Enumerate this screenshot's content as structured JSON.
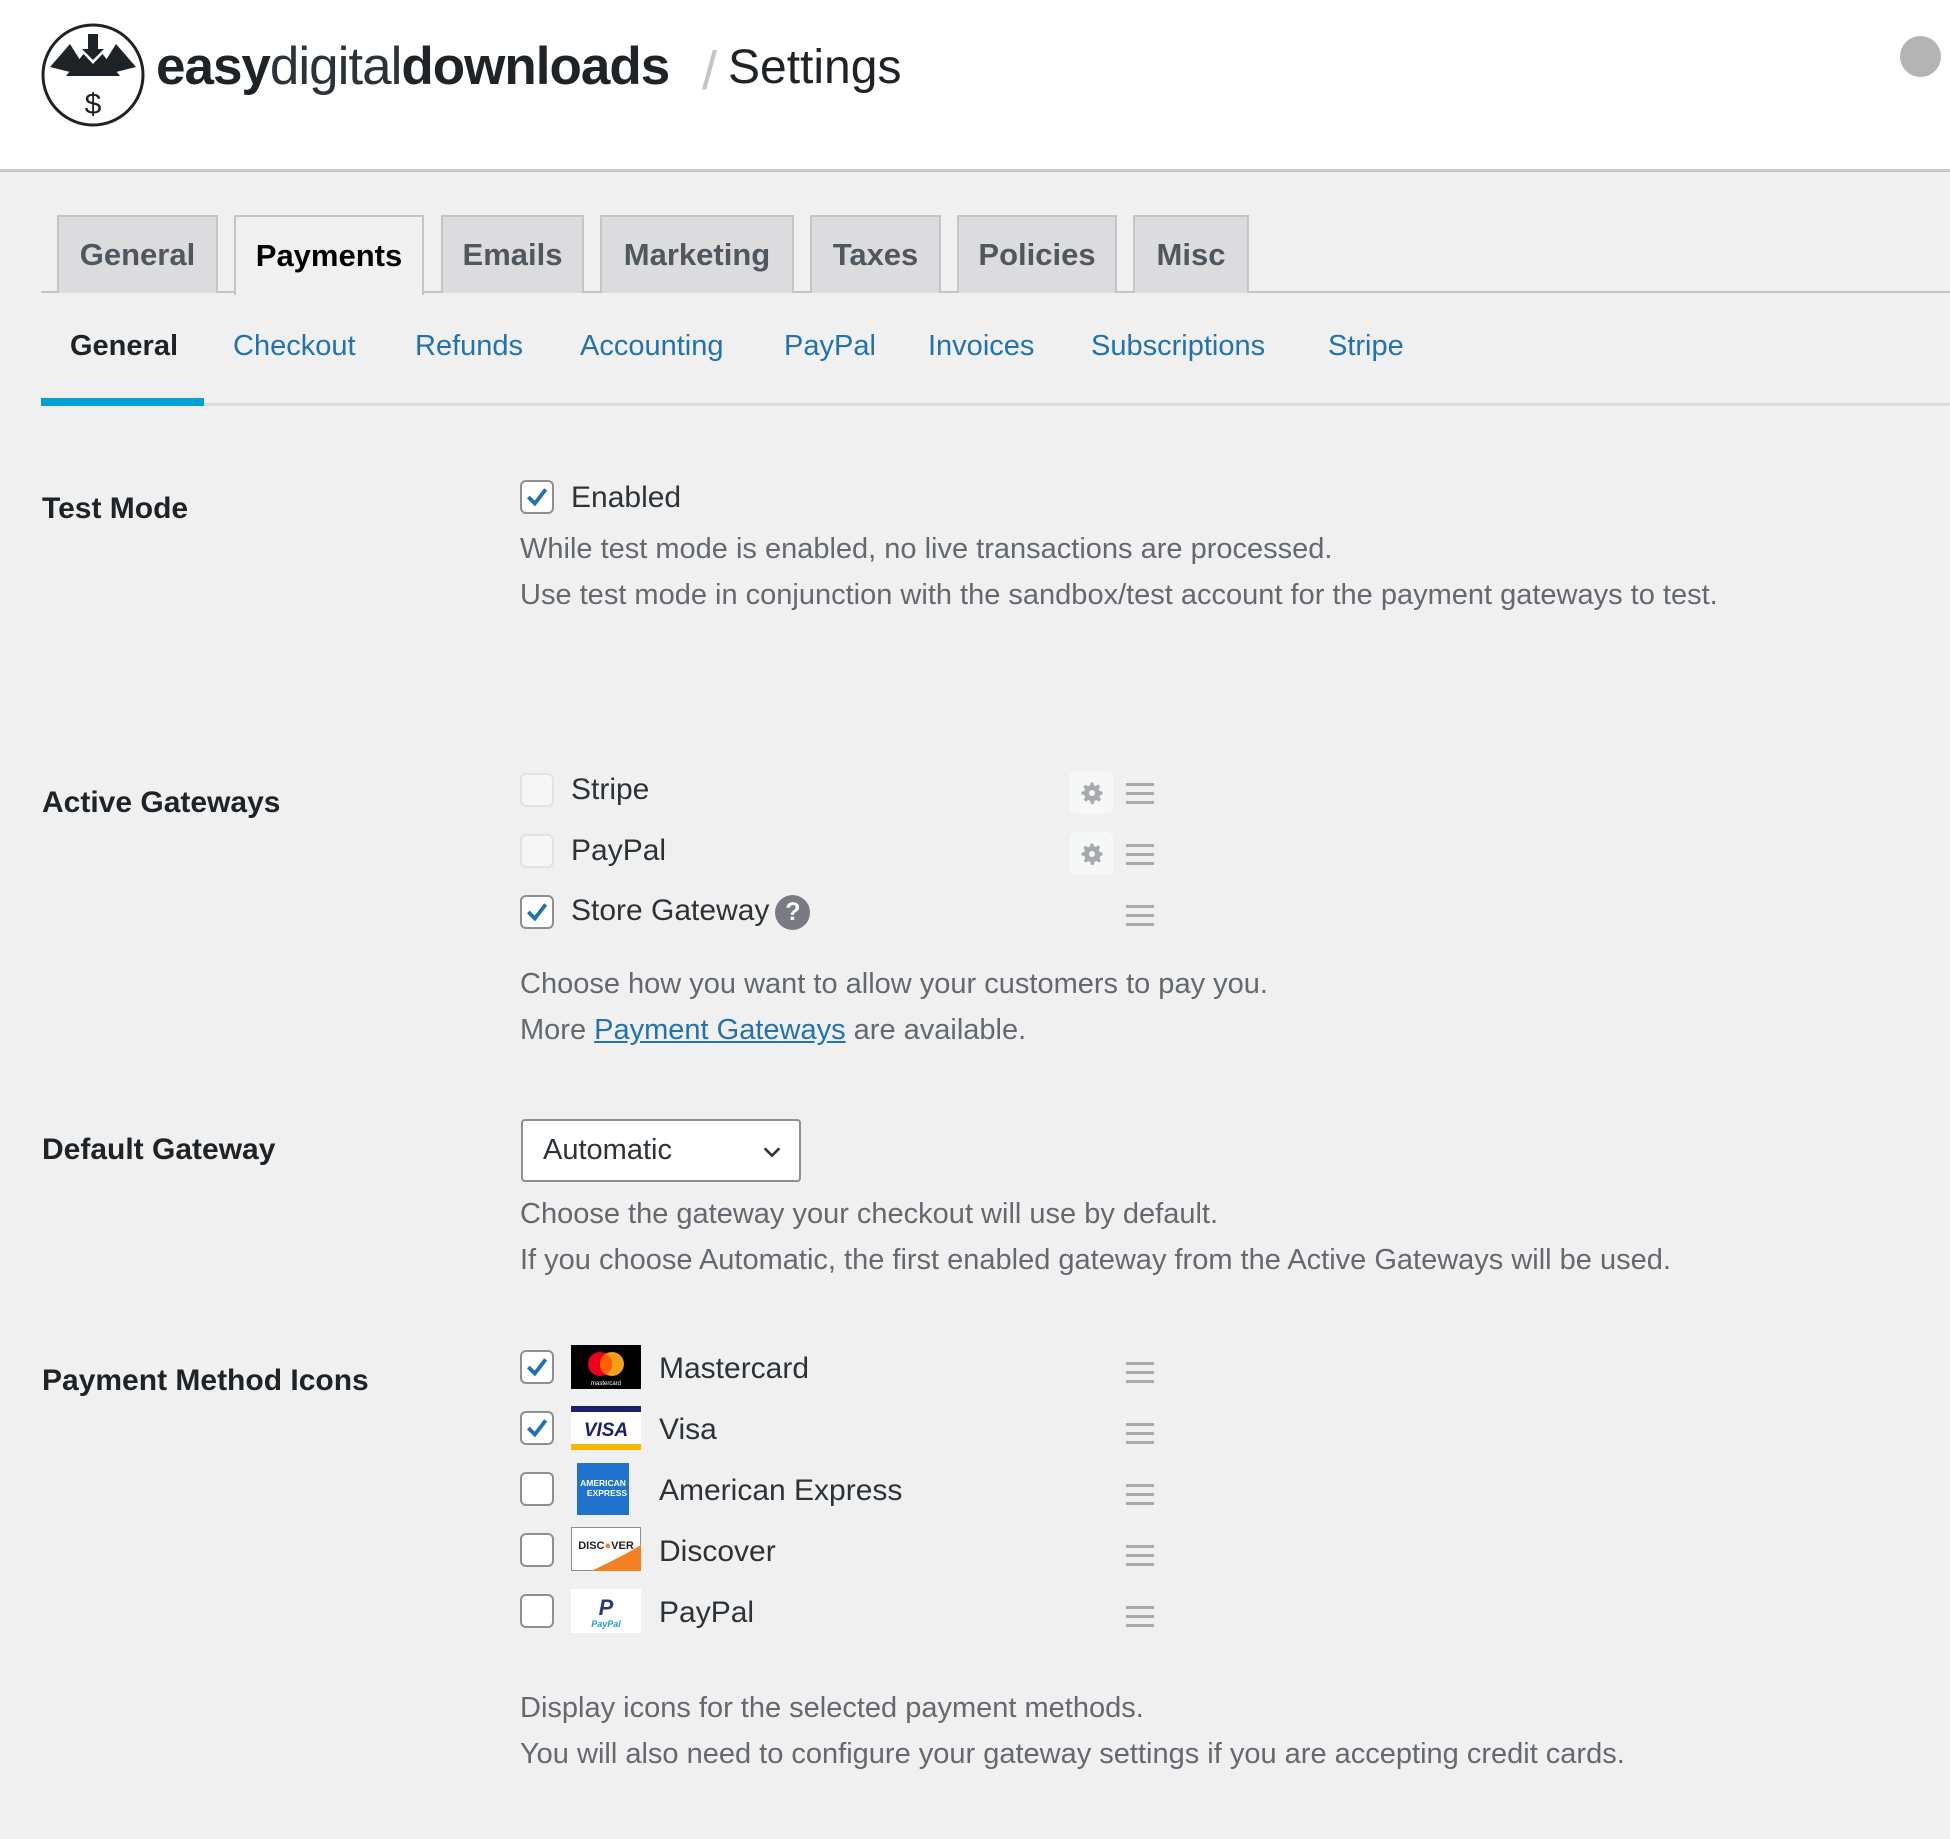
{
  "header": {
    "brand_easy": "easy",
    "brand_digital": "digital",
    "brand_downloads": "downloads",
    "separator": "/",
    "title": "Settings",
    "logo_icon": "edd-logo-icon"
  },
  "tabs": [
    {
      "label": "General",
      "active": false
    },
    {
      "label": "Payments",
      "active": true
    },
    {
      "label": "Emails",
      "active": false
    },
    {
      "label": "Marketing",
      "active": false
    },
    {
      "label": "Taxes",
      "active": false
    },
    {
      "label": "Policies",
      "active": false
    },
    {
      "label": "Misc",
      "active": false
    }
  ],
  "subtabs": [
    {
      "label": "General",
      "active": true
    },
    {
      "label": "Checkout",
      "active": false
    },
    {
      "label": "Refunds",
      "active": false
    },
    {
      "label": "Accounting",
      "active": false
    },
    {
      "label": "PayPal",
      "active": false
    },
    {
      "label": "Invoices",
      "active": false
    },
    {
      "label": "Subscriptions",
      "active": false
    },
    {
      "label": "Stripe",
      "active": false
    }
  ],
  "test_mode": {
    "label": "Test Mode",
    "checkbox_label": "Enabled",
    "checked": true,
    "desc1": "While test mode is enabled, no live transactions are processed.",
    "desc2": "Use test mode in conjunction with the sandbox/test account for the payment gateways to test."
  },
  "active_gateways": {
    "label": "Active Gateways",
    "items": [
      {
        "label": "Stripe",
        "checked": false,
        "disabled": true,
        "has_settings": true
      },
      {
        "label": "PayPal",
        "checked": false,
        "disabled": true,
        "has_settings": true
      },
      {
        "label": "Store Gateway",
        "checked": true,
        "disabled": false,
        "has_settings": false,
        "help": "?"
      }
    ],
    "desc1": "Choose how you want to allow your customers to pay you.",
    "desc2_prefix": "More",
    "desc2_link": "Payment Gateways",
    "desc2_suffix": "are available."
  },
  "default_gateway": {
    "label": "Default Gateway",
    "selected": "Automatic",
    "desc1": "Choose the gateway your checkout will use by default.",
    "desc2": "If you choose Automatic, the first enabled gateway from the Active Gateways will be used."
  },
  "payment_icons": {
    "label": "Payment Method Icons",
    "items": [
      {
        "label": "Mastercard",
        "checked": true,
        "icon": "mastercard-icon",
        "icon_text": "mastercard"
      },
      {
        "label": "Visa",
        "checked": true,
        "icon": "visa-icon",
        "icon_text": "VISA"
      },
      {
        "label": "American Express",
        "checked": false,
        "icon": "amex-icon",
        "icon_text": "AMERICAN EXPRESS"
      },
      {
        "label": "Discover",
        "checked": false,
        "icon": "discover-icon",
        "icon_text": "DISCOVER"
      },
      {
        "label": "PayPal",
        "checked": false,
        "icon": "paypal-icon",
        "icon_text": "PayPal"
      }
    ],
    "desc1": "Display icons for the selected payment methods.",
    "desc2": "You will also need to configure your gateway settings if you are accepting credit cards."
  },
  "colors": {
    "accent": "#00a0d2",
    "link": "#2271b1",
    "background": "#f0f0f1"
  }
}
